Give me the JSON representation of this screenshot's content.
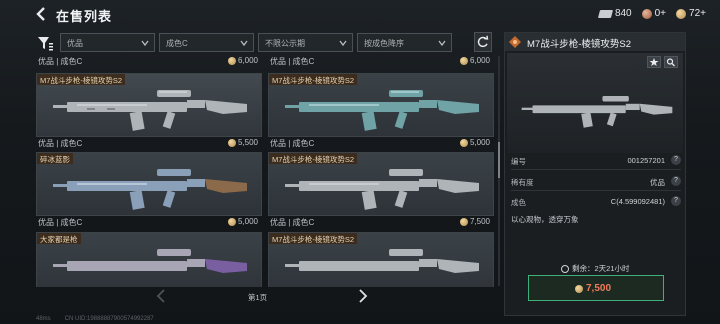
{
  "header": {
    "title": "在售列表",
    "currencies": [
      {
        "icon": "ticket-icon",
        "value": "840"
      },
      {
        "icon": "bronze-coin-icon",
        "value": "0+"
      },
      {
        "icon": "gold-coin-icon",
        "value": "72+"
      }
    ]
  },
  "filters": {
    "quality": "优品",
    "grade": "成色C",
    "publicity": "不限公示期",
    "sort": "按成色降序"
  },
  "listings": [
    {
      "top_grade": "优品 | 成色C",
      "top_price": "6,000",
      "name": "M7战斗步枪-棱镜攻势S2",
      "skin": "silver",
      "grade": "优品 | 成色C",
      "price": "5,500"
    },
    {
      "top_grade": "优品 | 成色C",
      "top_price": "6,000",
      "name": "M7战斗步枪-棱镜攻势S2",
      "skin": "teal",
      "grade": "优品 | 成色C",
      "price": "5,000"
    },
    {
      "name": "碎冰蓝影",
      "skin": "icy",
      "grade": "优品 | 成色C",
      "price": "5,000"
    },
    {
      "name": "M7战斗步枪-棱镜攻势S2",
      "skin": "silver",
      "grade": "优品 | 成色C",
      "price": "7,500"
    },
    {
      "name": "大家都是枪",
      "skin": "purple",
      "grade": "",
      "price": ""
    },
    {
      "name": "M7战斗步枪-棱镜攻势S2",
      "skin": "silver",
      "grade": "",
      "price": ""
    }
  ],
  "pager": {
    "page": "第1页"
  },
  "detail": {
    "name": "M7战斗步枪-棱镜攻势S2",
    "rows": [
      {
        "label": "编号",
        "value": "001257201"
      },
      {
        "label": "稀有度",
        "value": "优品"
      },
      {
        "label": "成色",
        "value": "C(4.599092481)"
      }
    ],
    "description": "以心观物，透穿万象",
    "remaining": "剩余：2天21小时",
    "price": "7,500"
  },
  "footer": {
    "ping": "48ms",
    "uid": "CN UID:19888887900574992287"
  },
  "colors": {
    "accent": "#3fb07a",
    "price": "#f07a5a",
    "tag_bg": "#3c2a19",
    "coin": "#c9a465"
  }
}
